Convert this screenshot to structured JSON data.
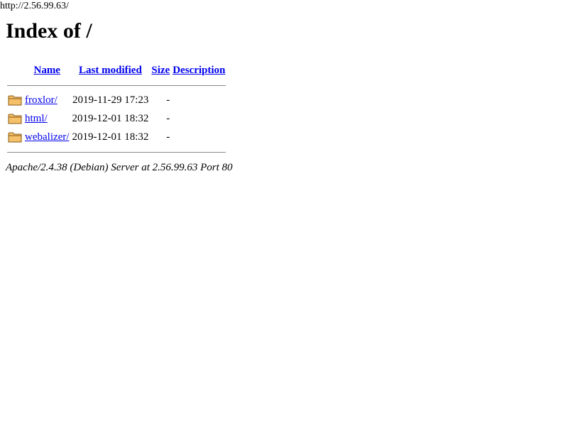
{
  "browser": {
    "url": "http://2.56.99.63/"
  },
  "page": {
    "title": "Index of /"
  },
  "table": {
    "headers": {
      "name": "Name",
      "modified": "Last modified",
      "size": "Size",
      "description": "Description"
    },
    "rows": [
      {
        "icon": "folder-icon",
        "name": "froxlor/",
        "modified": "2019-11-29 17:23",
        "size": "-",
        "description": ""
      },
      {
        "icon": "folder-icon",
        "name": "html/",
        "modified": "2019-12-01 18:32",
        "size": "-",
        "description": ""
      },
      {
        "icon": "folder-icon",
        "name": "webalizer/",
        "modified": "2019-12-01 18:32",
        "size": "-",
        "description": ""
      }
    ]
  },
  "footer": {
    "address": "Apache/2.4.38 (Debian) Server at 2.56.99.63 Port 80"
  },
  "colors": {
    "link": "#0000ee",
    "folder": "#e8a33a"
  }
}
